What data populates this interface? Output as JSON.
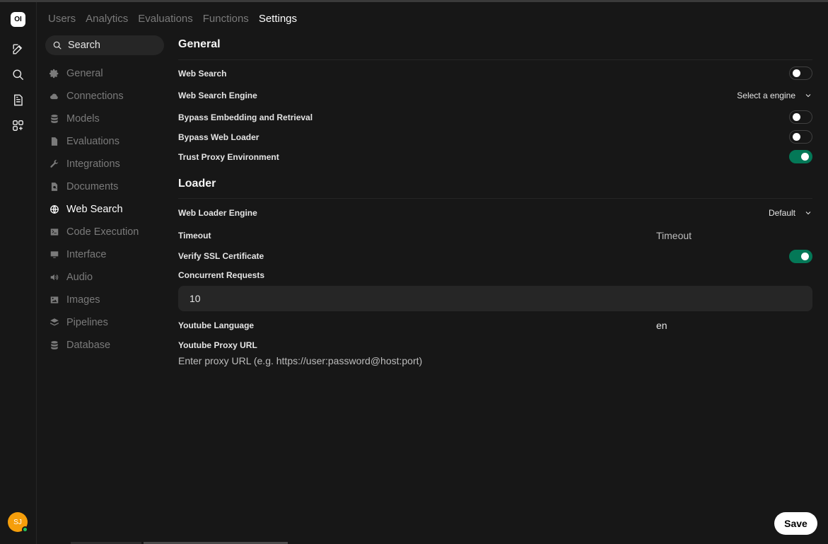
{
  "rail": {
    "logo_text": "OI",
    "avatar_initials": "SJ",
    "icons": [
      "new-chat-icon",
      "search-icon",
      "notes-icon",
      "workspace-icon"
    ]
  },
  "tabs": [
    {
      "label": "Users"
    },
    {
      "label": "Analytics"
    },
    {
      "label": "Evaluations"
    },
    {
      "label": "Functions"
    },
    {
      "label": "Settings",
      "active": true
    }
  ],
  "sidebar": {
    "search_label": "Search",
    "items": [
      {
        "label": "General",
        "icon": "gear-icon"
      },
      {
        "label": "Connections",
        "icon": "cloud-icon"
      },
      {
        "label": "Models",
        "icon": "database-icon"
      },
      {
        "label": "Evaluations",
        "icon": "document-icon"
      },
      {
        "label": "Integrations",
        "icon": "wrench-icon"
      },
      {
        "label": "Documents",
        "icon": "document-search-icon"
      },
      {
        "label": "Web Search",
        "icon": "globe-icon",
        "active": true
      },
      {
        "label": "Code Execution",
        "icon": "terminal-icon"
      },
      {
        "label": "Interface",
        "icon": "monitor-icon"
      },
      {
        "label": "Audio",
        "icon": "speaker-icon"
      },
      {
        "label": "Images",
        "icon": "image-icon"
      },
      {
        "label": "Pipelines",
        "icon": "layers-icon"
      },
      {
        "label": "Database",
        "icon": "database-icon"
      }
    ]
  },
  "general": {
    "heading": "General",
    "web_search_label": "Web Search",
    "web_search_on": false,
    "engine_label": "Web Search Engine",
    "engine_value": "Select a engine",
    "bypass_embedding_label": "Bypass Embedding and Retrieval",
    "bypass_embedding_on": false,
    "bypass_loader_label": "Bypass Web Loader",
    "bypass_loader_on": false,
    "trust_proxy_label": "Trust Proxy Environment",
    "trust_proxy_on": true
  },
  "loader": {
    "heading": "Loader",
    "engine_label": "Web Loader Engine",
    "engine_value": "Default",
    "timeout_label": "Timeout",
    "timeout_placeholder": "Timeout",
    "verify_ssl_label": "Verify SSL Certificate",
    "verify_ssl_on": true,
    "concurrent_label": "Concurrent Requests",
    "concurrent_value": "10",
    "youtube_lang_label": "Youtube Language",
    "youtube_lang_value": "en",
    "youtube_proxy_label": "Youtube Proxy URL",
    "youtube_proxy_placeholder": "Enter proxy URL (e.g. https://user:password@host:port)"
  },
  "save_label": "Save",
  "colors": {
    "toggle_on": "#047857",
    "avatar": "#f59e0b",
    "online": "#22c55e"
  }
}
